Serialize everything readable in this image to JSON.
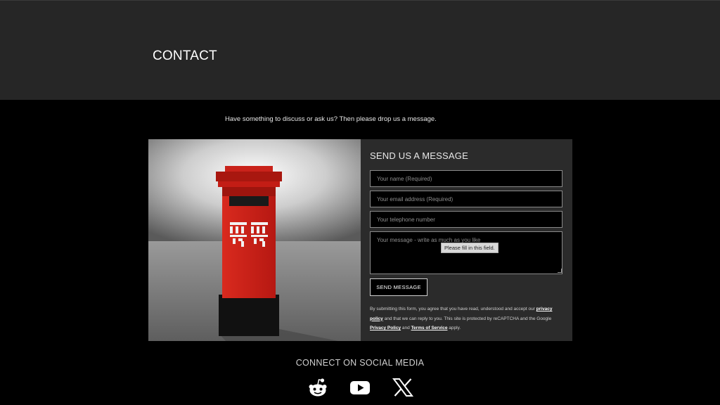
{
  "header": {
    "title": "CONTACT"
  },
  "intro": "Have something to discuss or ask us? Then please drop us a message.",
  "form": {
    "heading": "SEND US A MESSAGE",
    "name_placeholder": "Your name (Required)",
    "email_placeholder": "Your email address (Required)",
    "phone_placeholder": "Your telephone number",
    "message_placeholder": "Your message - write as much as you like",
    "validation_tooltip": "Please fill in this field.",
    "submit_label": "SEND MESSAGE",
    "legal": {
      "text1": "By submitting this form, you agree that you have read, understood and accept our ",
      "privacy_link_label": "privacy policy",
      "text2": " and that we can reply to you. This site is protected by reCAPTCHA and the Google ",
      "google_privacy_label": "Privacy Policy",
      "text3": " and ",
      "google_terms_label": "Terms of Service",
      "text4": " apply."
    }
  },
  "social": {
    "heading": "CONNECT ON SOCIAL MEDIA",
    "icons": [
      "reddit-icon",
      "youtube-icon",
      "x-icon"
    ]
  },
  "colors": {
    "header_bg": "#262626",
    "page_bg": "#000000",
    "card_bg": "#2b2b2b",
    "postbox_red": "#c8201a"
  }
}
